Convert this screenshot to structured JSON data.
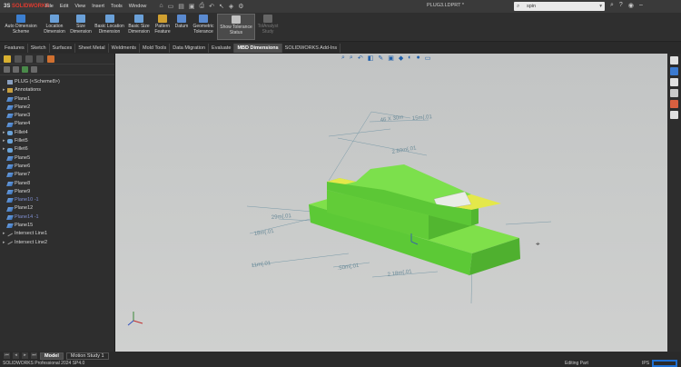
{
  "app": {
    "brand": "SOLIDWORKS",
    "logo_mark": "3S",
    "doc_title": "PLUG3.LDPRT *"
  },
  "menu": [
    "File",
    "Edit",
    "View",
    "Insert",
    "Tools",
    "Window"
  ],
  "search": {
    "value": "spin"
  },
  "ribbon": {
    "items": [
      {
        "label": "Auto Dimension Scheme",
        "color": "#3c7fd0"
      },
      {
        "label": "Location Dimension",
        "color": "#6aa0d8"
      },
      {
        "label": "Size Dimension",
        "color": "#6aa0d8"
      },
      {
        "label": "Basic Location Dimension",
        "color": "#6aa0d8"
      },
      {
        "label": "Basic Size Dimension",
        "color": "#6aa0d8"
      },
      {
        "label": "Pattern Feature",
        "color": "#d0a030"
      },
      {
        "label": "Datum",
        "color": "#5a8ad0"
      },
      {
        "label": "Geometric Tolerance",
        "color": "#5a8ad0"
      },
      {
        "label": "Show Tolerance Status",
        "color": "#c0c0c0"
      },
      {
        "label": "TolAnalyst Study",
        "color": "#777777"
      }
    ]
  },
  "tabs": [
    "Features",
    "Sketch",
    "Surfaces",
    "Sheet Metal",
    "Weldments",
    "Mold Tools",
    "Data Migration",
    "Evaluate",
    "MBD Dimensions",
    "SOLIDWORKS Add-Ins"
  ],
  "active_tab": "MBD Dimensions",
  "tree": {
    "root": "PLUG  (<Scheme8>)",
    "items": [
      {
        "label": "Annotations",
        "type": "annotations",
        "expand": true
      },
      {
        "label": "Plane1",
        "type": "plane"
      },
      {
        "label": "Plane2",
        "type": "plane"
      },
      {
        "label": "Plane3",
        "type": "plane"
      },
      {
        "label": "Plane4",
        "type": "plane"
      },
      {
        "label": "Fillet4",
        "type": "fillet",
        "expand": true
      },
      {
        "label": "Fillet5",
        "type": "fillet",
        "expand": true
      },
      {
        "label": "Fillet6",
        "type": "fillet",
        "expand": true
      },
      {
        "label": "Plane5",
        "type": "plane"
      },
      {
        "label": "Plane6",
        "type": "plane"
      },
      {
        "label": "Plane7",
        "type": "plane"
      },
      {
        "label": "Plane8",
        "type": "plane"
      },
      {
        "label": "Plane9",
        "type": "plane"
      },
      {
        "label": "Plane10 -1",
        "type": "plane",
        "suppressed": true
      },
      {
        "label": "Plane12",
        "type": "plane"
      },
      {
        "label": "Plane14 -1",
        "type": "plane",
        "suppressed": true
      },
      {
        "label": "Plane15",
        "type": "plane"
      },
      {
        "label": "Intersect Line1",
        "type": "line",
        "expand": true
      },
      {
        "label": "Intersect Line2",
        "type": "line",
        "expand": true
      }
    ]
  },
  "dimensions": [
    "46 X 30m",
    "15m{.01",
    "2.80m{.01",
    "29m{.01",
    "18m{.01",
    "11m{.01",
    ".50m{.01",
    "2.18m{.01"
  ],
  "bottom_tabs": [
    "Model",
    "Motion Study 1"
  ],
  "status": {
    "left": "SOLIDWORKS Professional 2024 SP4.0",
    "mid": "Editing Part",
    "units": "IPS"
  },
  "colors": {
    "part_green": "#6ad43a",
    "part_yellow": "#d8e040",
    "accent_blue": "#1f6fd1"
  }
}
